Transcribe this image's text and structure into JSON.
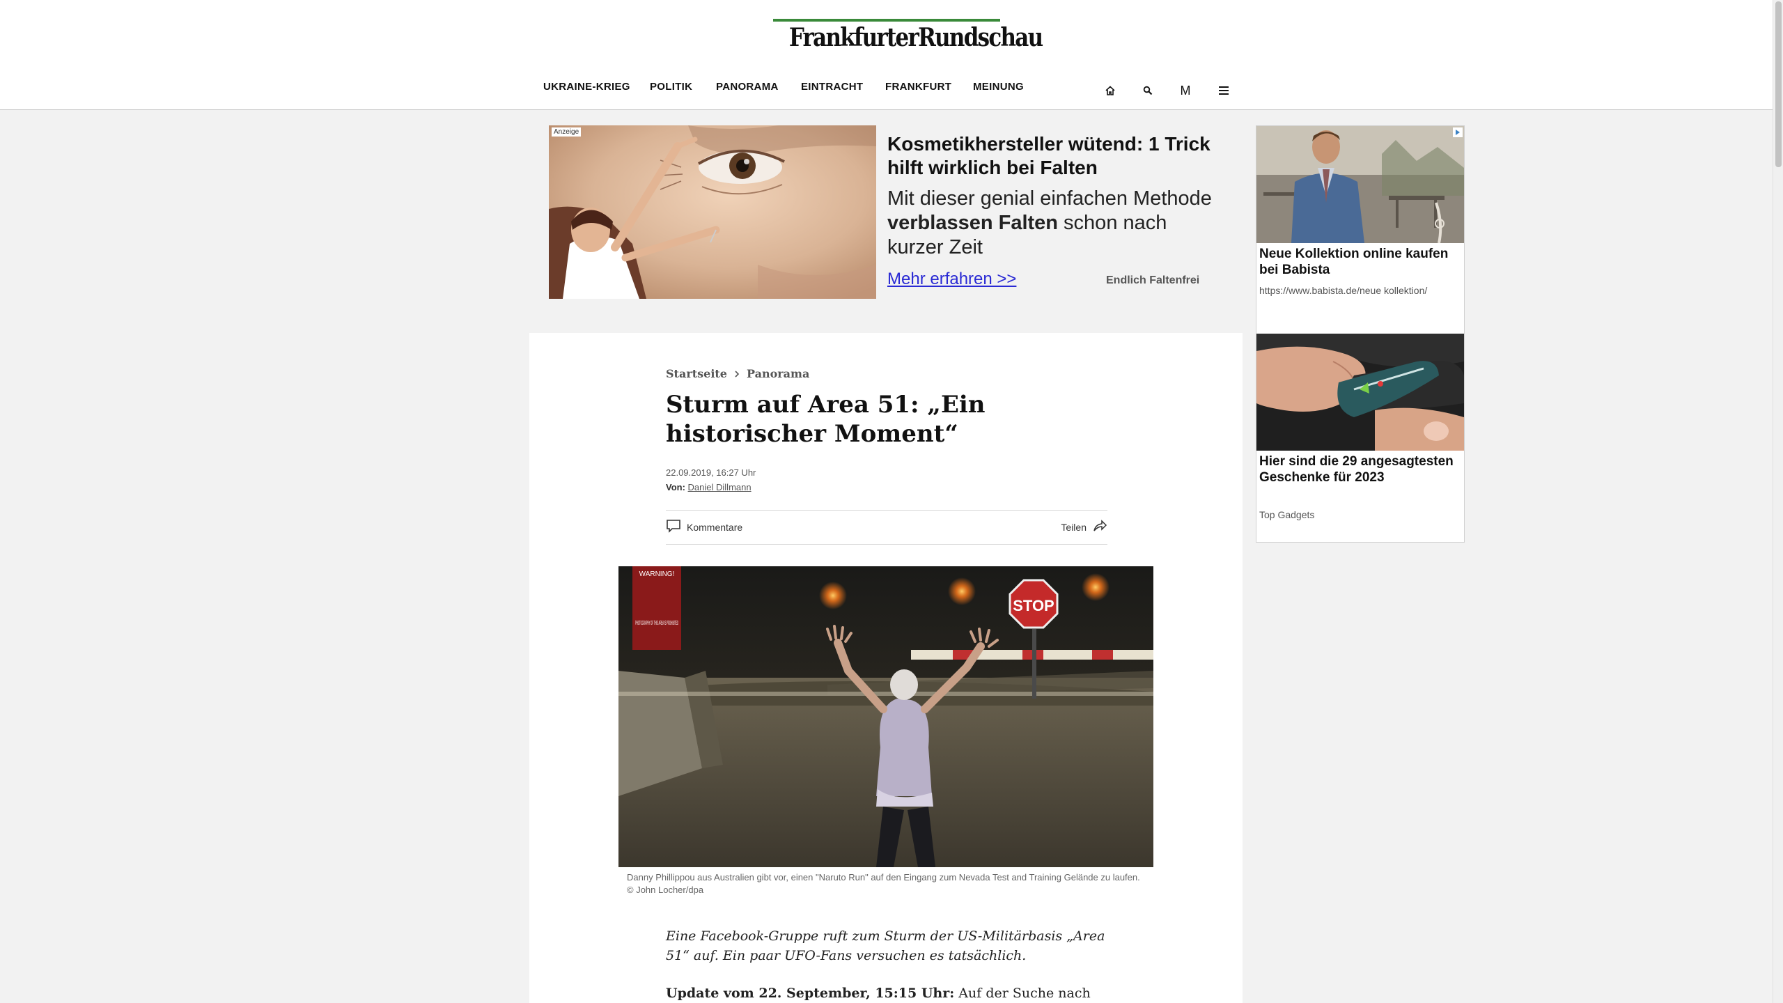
{
  "header": {
    "logo": "FrankfurterRundschau",
    "nav": [
      "UKRAINE-KRIEG",
      "POLITIK",
      "PANORAMA",
      "EINTRACHT",
      "FRANKFURT",
      "MEINUNG"
    ],
    "icons": [
      "home-icon",
      "search-icon",
      "merkliste-icon",
      "menu-icon"
    ],
    "merkliste_glyph": "M"
  },
  "top_ad": {
    "label": "Anzeige",
    "headline": "Kosmetikhersteller wütend: 1 Trick hilft wirklich bei Falten",
    "desc_pre": "Mit dieser genial einfachen Methode ",
    "desc_bold": "verblassen Falten",
    "desc_post": " schon nach kurzer Zeit",
    "cta": "Mehr erfahren >>",
    "brand": "Endlich Faltenfrei"
  },
  "side_ads": [
    {
      "title": "Neue Kollektion online kaufen bei Babista",
      "sub": "https://www.babista.de/neue kollektion/"
    },
    {
      "title": "Hier sind die 29 angesagtesten Geschenke für 2023",
      "sub": "Top Gadgets"
    }
  ],
  "article": {
    "breadcrumb": [
      "Startseite",
      "Panorama"
    ],
    "headline": "Sturm auf Area 51: „Ein historischer Moment“",
    "date": "22.09.2019, 16:27 Uhr",
    "author_label": "Von:",
    "author": "Daniel Dillmann",
    "comments_label": "Kommentare",
    "share_label": "Teilen",
    "image_caption": "Danny Phillippou aus Australien gibt vor, einen \"Naruto Run\" auf den Eingang zum Nevada Test and Training Gelände zu laufen.",
    "image_credit": "© John Locher/dpa",
    "image_sign_warning": "WARNING!",
    "image_sign_text": "PHOTOGRAPHY OF THIS AREA IS PROHIBITED",
    "image_stop": "STOP",
    "teaser": "Eine Facebook-Gruppe ruft zum Sturm der US-Militärbasis „Area 51“ auf. Ein paar UFO-Fans versuchen es tatsächlich.",
    "update_bold": "Update vom 22. September, 15:15 Uhr:",
    "update_text": " Auf der Suche nach"
  },
  "colors": {
    "logo_bar": "#3a8a3a",
    "link": "#2a2ad4",
    "page_bg": "#f2f2f2"
  }
}
